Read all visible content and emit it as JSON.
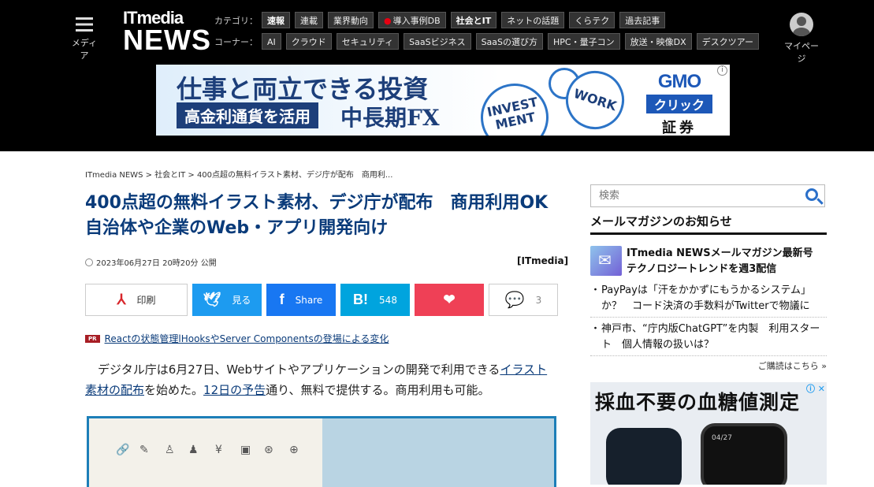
{
  "header": {
    "menu_label": "メディア",
    "logo_top": "ITmedia",
    "logo_bottom": "NEWS",
    "category_label": "カテゴリ：",
    "categories": [
      "速報",
      "連載",
      "業界動向",
      "導入事例DB",
      "社会とIT",
      "ネットの話題",
      "くらテク",
      "過去記事"
    ],
    "corner_label": "コーナー：",
    "corners": [
      "AI",
      "クラウド",
      "セキュリティ",
      "SaaSビジネス",
      "SaaSの選び方",
      "HPC・量子コン",
      "放送・映像DX",
      "デスクツアー"
    ],
    "mypage_label": "マイページ"
  },
  "banner_ad": {
    "headline": "仕事と両立できる投資",
    "sub": "高金利通貨を活用",
    "fx": "中長期FX",
    "circle1": "INVEST MENT",
    "circle2": "WORK",
    "brand_top": "GMO",
    "brand_mid": "クリック",
    "brand_bottom": "証券",
    "info": "i"
  },
  "breadcrumb": "ITmedia NEWS > 社会とIT > 400点超の無料イラスト素材、デジ庁が配布　商用利...",
  "article": {
    "title": "400点超の無料イラスト素材、デジ庁が配布　商用利用OK　自治体や企業のWeb・アプリ開発向け",
    "date": "2023年06月27日 20時20分 公開",
    "source": "[ITmedia]",
    "share": {
      "print": "印刷",
      "twitter": "見る",
      "facebook": "Share",
      "hatena_icon": "B!",
      "hatena": "548",
      "pocket_icon": "❤",
      "comment": "3"
    },
    "pr_badge": "PR",
    "pr_text": "Reactの状態管理lHooksやServer Componentsの登場による変化",
    "body_1": "デジタル庁は6月27日、Webサイトやアプリケーションの開発で利用できる",
    "body_link1": "イラスト素材の配布",
    "body_2": "を始めた。",
    "body_link2": "12日の予告",
    "body_3": "通り、無料で提供する。商用利用も可能。"
  },
  "sidebar": {
    "search_placeholder": "検索",
    "mail_heading": "メールマガジンのお知らせ",
    "mail_top": "ITmedia NEWSメールマガジン最新号 テクノロジートレンドを週3配信",
    "mail_items": [
      "PayPayは「汗をかかずにもうかるシステム」か？　コード決済の手数料がTwitterで物議に",
      "神戸市、“庁内版ChatGPT”を内製　利用スタート　個人情報の扱いは？"
    ],
    "more": "ご購読はこちら »",
    "ad_headline": "採血不要の血糖値測定",
    "ad_close": "ⓘ ✕",
    "ad_screen": "04/27"
  },
  "colors": {
    "title_blue": "#0a3b7a",
    "twitter": "#1d9bf0",
    "facebook": "#1877f2",
    "hatena": "#00a4de",
    "pocket": "#ef4056",
    "pr_badge": "#a71d24"
  }
}
